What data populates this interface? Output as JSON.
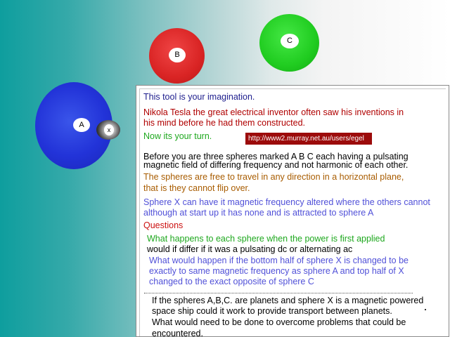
{
  "spheres": {
    "a": {
      "label": "A",
      "color": "#2233d8"
    },
    "b": {
      "label": "B",
      "color": "#d92424"
    },
    "c": {
      "label": "C",
      "color": "#20cc20"
    },
    "x": {
      "label": "x",
      "color": "#111111"
    }
  },
  "panel": {
    "title": "This tool is your imagination.",
    "tesla_line1": "Nikola  Tesla  the great electrical inventor often saw his inventions in",
    "tesla_line2": "his mind before he had them constructed.",
    "turn": "Now its your turn.",
    "url": "http://www2.murray.net.au/users/egel",
    "before_line1": "Before you are three spheres marked A B C  each having a pulsating",
    "before_line2": "magnetic field of differing frequency and not harmonic of each other.",
    "free_line1": "The spheres are free to travel in any direction in a horizontal plane,",
    "free_line2": "that is they cannot flip over.",
    "spherex_line1": "Sphere X  can have it magnetic frequency altered where the others cannot",
    "spherex_line2": "although at start up it has none and is attracted to sphere A",
    "questions": "Questions",
    "q1_line1": "What happens to each sphere when the power  is first applied",
    "q1_line2": "would if differ if it was a pulsating dc  or alternating ac",
    "q2_line1": "What would happen if the bottom half of sphere X is changed to be",
    "q2_line2": "exactly to same magnetic frequency as sphere A and top half of X",
    "q2_line3": "changed to the exact opposite  of sphere  C",
    "q3_line1": "If the spheres A,B,C. are planets and sphere X is a magnetic powered",
    "q3_line2": "space ship could it work to provide transport between planets.",
    "q3_line3": "What would need to be done to overcome problems that could be",
    "q3_line4": "encountered."
  },
  "colors": {
    "background_left": "#0e9e9e",
    "panel_bg": "#ffffff",
    "url_bg": "#9c0b0b"
  }
}
